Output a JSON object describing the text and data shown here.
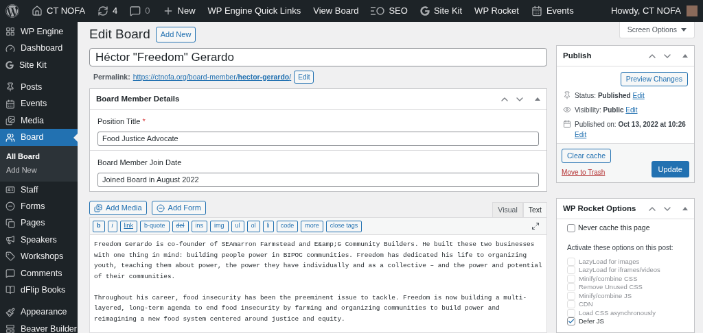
{
  "admin_bar": {
    "items": [
      {
        "kind": "wordpress"
      },
      {
        "kind": "home",
        "label": "CT NOFA"
      },
      {
        "kind": "updates",
        "label": "4"
      },
      {
        "kind": "comments",
        "label": "0"
      },
      {
        "kind": "new",
        "label": "New"
      },
      {
        "kind": "plain",
        "label": "WP Engine Quick Links"
      },
      {
        "kind": "plain",
        "label": "View Board"
      },
      {
        "kind": "seo",
        "label": "SEO"
      },
      {
        "kind": "google",
        "label": "Site Kit"
      },
      {
        "kind": "plain",
        "label": "WP Rocket"
      },
      {
        "kind": "events",
        "label": "Events"
      }
    ],
    "greeting": "Howdy, CT NOFA"
  },
  "sidebar": {
    "groups": [
      {
        "items": [
          {
            "kind": "grid",
            "label": "WP Engine",
            "selected": false
          },
          {
            "kind": "gauge",
            "label": "Dashboard",
            "selected": false
          },
          {
            "kind": "google",
            "label": "Site Kit",
            "selected": false
          }
        ]
      },
      {
        "items": [
          {
            "kind": "pin",
            "label": "Posts",
            "selected": false
          },
          {
            "kind": "events",
            "label": "Events",
            "selected": false
          },
          {
            "kind": "media",
            "label": "Media",
            "selected": false
          },
          {
            "kind": "people",
            "label": "Board",
            "selected": true,
            "children": [
              {
                "label": "All Board",
                "selected": true
              },
              {
                "label": "Add New",
                "selected": false
              }
            ]
          },
          {
            "kind": "idcard",
            "label": "Staff",
            "selected": false
          },
          {
            "kind": "form",
            "label": "Forms",
            "selected": false
          },
          {
            "kind": "pages",
            "label": "Pages",
            "selected": false
          },
          {
            "kind": "megaphone",
            "label": "Speakers",
            "selected": false
          },
          {
            "kind": "tag",
            "label": "Workshops",
            "selected": false
          },
          {
            "kind": "comments",
            "label": "Comments",
            "selected": false
          },
          {
            "kind": "book",
            "label": "dFlip Books",
            "selected": false
          }
        ]
      },
      {
        "items": [
          {
            "kind": "brush",
            "label": "Appearance",
            "selected": false
          },
          {
            "kind": "layout",
            "label": "Beaver Builder",
            "selected": false
          }
        ]
      }
    ]
  },
  "screen_options": "Screen Options",
  "heading": "Edit Board",
  "add_new": "Add New",
  "title_value": "Héctor \"Freedom\" Gerardo",
  "permalink": {
    "label": "Permalink:",
    "url_prefix": "https://ctnofa.org/board-member/",
    "slug": "hector-gerardo",
    "suffix": "/",
    "edit": "Edit"
  },
  "details_box": {
    "title": "Board Member Details",
    "fields": [
      {
        "label": "Position Title",
        "required_mark": "*",
        "value": "Food Justice Advocate"
      },
      {
        "label": "Board Member Join Date",
        "value": "Joined Board in August 2022"
      }
    ]
  },
  "editor": {
    "media_buttons": [
      {
        "kind": "media",
        "label": "Add Media"
      },
      {
        "kind": "form",
        "label": "Add Form"
      }
    ],
    "tabs": [
      {
        "label": "Visual",
        "selected": false
      },
      {
        "label": "Text",
        "selected": true
      }
    ],
    "quicktags": [
      {
        "label": "b",
        "kind": "bold"
      },
      {
        "label": "i",
        "kind": "italic"
      },
      {
        "label": "link",
        "kind": "link"
      },
      {
        "label": "b-quote",
        "kind": "plain"
      },
      {
        "label": "del",
        "kind": "strike"
      },
      {
        "label": "ins",
        "kind": "plain"
      },
      {
        "label": "img",
        "kind": "plain"
      },
      {
        "label": "ul",
        "kind": "plain"
      },
      {
        "label": "ol",
        "kind": "plain"
      },
      {
        "label": "li",
        "kind": "plain"
      },
      {
        "label": "code",
        "kind": "plain"
      },
      {
        "label": "more",
        "kind": "plain"
      },
      {
        "label": "close tags",
        "kind": "plain"
      }
    ],
    "paragraphs": [
      "Freedom Gerardo is co-founder of SEAmarron Farmstead and E&amp;G Community Builders. He built these two businesses with one thing in mind: building people power in BIPOC communities. Freedom has dedicated his life to organizing youth, teaching them about power, the power they have individually and as a collective – and the power and potential of their communities.",
      "Throughout his career, food insecurity has been the preeminent issue to tackle. Freedom is now building a multi-layered, long-term agenda to end food insecurity by farming and organizing communities to build power and reimagining a new food system centered around justice and equity."
    ]
  },
  "publish": {
    "title": "Publish",
    "preview": "Preview Changes",
    "rows": [
      {
        "kind": "pin",
        "label": "Status:",
        "value": "Published",
        "edit": "Edit"
      },
      {
        "kind": "eye",
        "label": "Visibility:",
        "value": "Public",
        "edit": "Edit"
      },
      {
        "kind": "calendar",
        "label": "Published on:",
        "value": "Oct 13, 2022 at 10:26",
        "edit": "Edit"
      }
    ],
    "clear_cache": "Clear cache",
    "trash": "Move to Trash",
    "update": "Update"
  },
  "rocket": {
    "title": "WP Rocket Options",
    "never_cache": {
      "label": "Never cache this page",
      "checked": false
    },
    "intro": "Activate these options on this post:",
    "options": [
      {
        "label": "LazyLoad for images",
        "checked": false,
        "disabled": true
      },
      {
        "label": "LazyLoad for iframes/videos",
        "checked": false,
        "disabled": true
      },
      {
        "label": "Minify/combine CSS",
        "checked": false,
        "disabled": true
      },
      {
        "label": "Remove Unused CSS",
        "checked": false,
        "disabled": true
      },
      {
        "label": "Minify/combine JS",
        "checked": false,
        "disabled": true
      },
      {
        "label": "CDN",
        "checked": false,
        "disabled": true
      },
      {
        "label": "Load CSS asynchronously",
        "checked": false,
        "disabled": true
      },
      {
        "label": "Defer JS",
        "checked": true,
        "disabled": false
      }
    ]
  }
}
